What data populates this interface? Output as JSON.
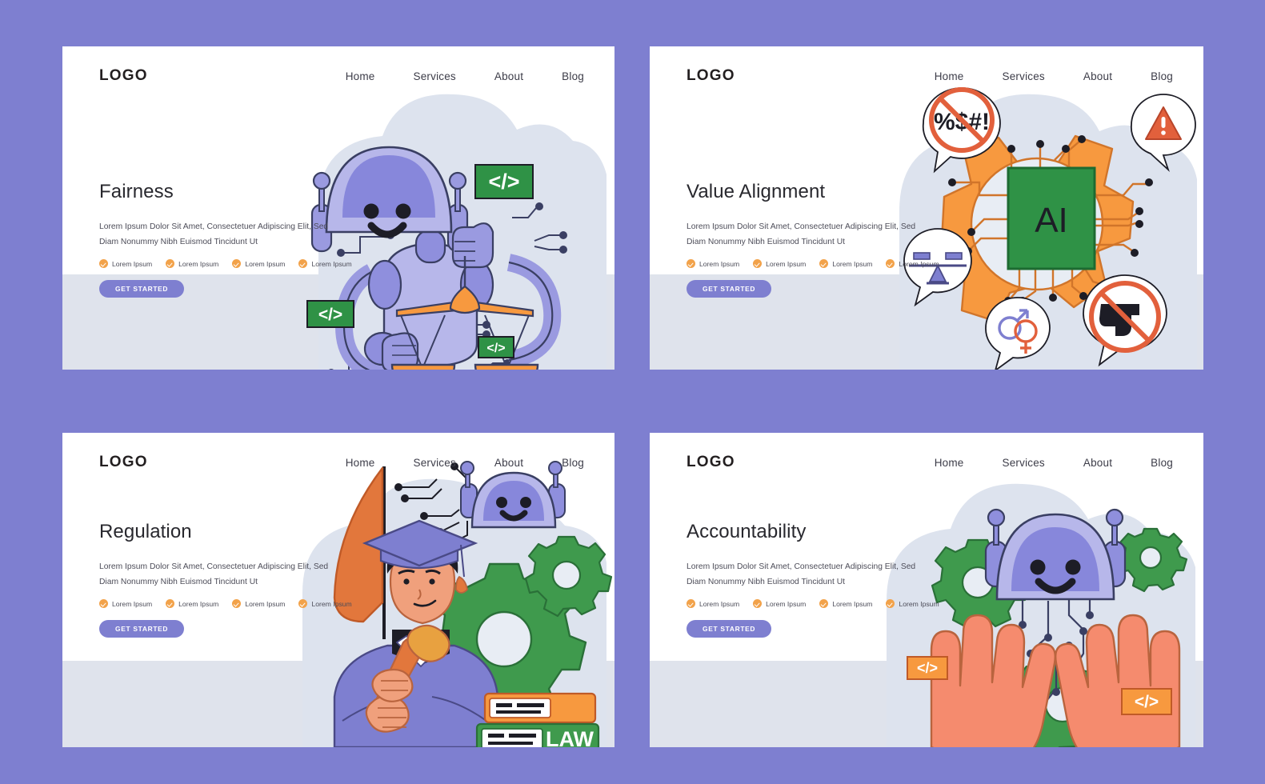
{
  "page": {
    "background_color": "#7e7fd0",
    "card_background": "#ffffff",
    "card_band_color": "#dfe3ec",
    "accent_purple": "#7e7fd0",
    "accent_orange": "#f2913d",
    "accent_green": "#2f9246",
    "skin_color": "#f58b6e"
  },
  "nav": {
    "logo": "LOGO",
    "links": [
      {
        "label": "Home"
      },
      {
        "label": "Services"
      },
      {
        "label": "About"
      },
      {
        "label": "Blog"
      }
    ]
  },
  "shared": {
    "paragraph": "Lorem Ipsum Dolor Sit Amet, Consectetuer Adipiscing Elit, Sed Diam Nonummy Nibh Euismod Tincidunt Ut",
    "feature_label": "Lorem Ipsum",
    "cta_label": "GET STARTED",
    "code_badge": "</>"
  },
  "cards": [
    {
      "id": "fairness",
      "title": "Fairness",
      "paragraph": "Lorem Ipsum Dolor Sit Amet, Consectetuer Adipiscing Elit, Sed Diam Nonummy Nibh Euismod Tincidunt Ut",
      "features": [
        "Lorem Ipsum",
        "Lorem Ipsum",
        "Lorem Ipsum",
        "Lorem Ipsum"
      ],
      "cta": "GET STARTED",
      "illustration": "robot-holding-scales-of-justice",
      "illustration_badges": [
        "</>",
        "</>",
        "</>"
      ]
    },
    {
      "id": "value-alignment",
      "title": "Value Alignment",
      "paragraph": "Lorem Ipsum Dolor Sit Amet, Consectetuer Adipiscing Elit, Sed Diam Nonummy Nibh Euismod Tincidunt Ut",
      "features": [
        "Lorem Ipsum",
        "Lorem Ipsum",
        "Lorem Ipsum",
        "Lorem Ipsum"
      ],
      "cta": "GET STARTED",
      "illustration": "ai-chip-inside-gear-with-value-bubbles",
      "chip_label": "AI",
      "bubbles": [
        "no-profanity",
        "warning",
        "balance-scale",
        "gender-equality",
        "no-weapons"
      ],
      "profanity_text": "%$#!"
    },
    {
      "id": "regulation",
      "title": "Regulation",
      "paragraph": "Lorem Ipsum Dolor Sit Amet, Consectetuer Adipiscing Elit, Sed Diam Nonummy Nibh Euismod Tincidunt Ut",
      "features": [
        "Lorem Ipsum",
        "Lorem Ipsum",
        "Lorem Ipsum",
        "Lorem Ipsum"
      ],
      "cta": "GET STARTED",
      "illustration": "graduate-with-gavel-flag-and-law-books",
      "book_label": "LAW"
    },
    {
      "id": "accountability",
      "title": "Accountability",
      "paragraph": "Lorem Ipsum Dolor Sit Amet, Consectetuer Adipiscing Elit, Sed Diam Nonummy Nibh Euismod Tincidunt Ut",
      "features": [
        "Lorem Ipsum",
        "Lorem Ipsum",
        "Lorem Ipsum",
        "Lorem Ipsum"
      ],
      "cta": "GET STARTED",
      "illustration": "hands-holding-robot-head-with-gears",
      "illustration_badges": [
        "</>",
        "</>"
      ]
    }
  ]
}
